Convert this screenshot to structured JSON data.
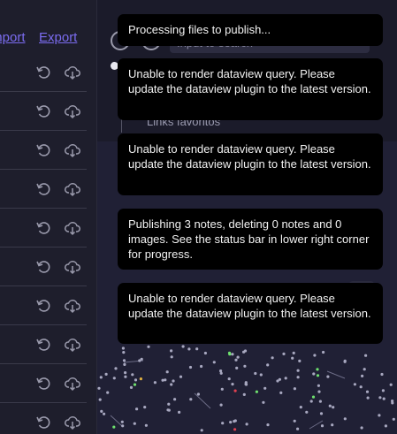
{
  "left_pane": {
    "links": {
      "import": "Import",
      "export": "Export"
    },
    "row_count": 10,
    "icons": {
      "reset": "reset-icon",
      "upload": "cloud-upload-icon"
    }
  },
  "right_pane": {
    "search_placeholder": "Input to search",
    "favorites_label": "Links favoritos",
    "icons": {
      "settings": "gear-icon",
      "magic": "wand-icon"
    }
  },
  "notices": [
    {
      "text": "Processing files to publish..."
    },
    {
      "text": "Unable to render dataview query. Please update the dataview plugin to the latest version."
    },
    {
      "text": "Unable to render dataview query. Please update the dataview plugin to the latest version."
    },
    {
      "text": "Publishing 3 notes, deleting 0 notes and 0 images. See the status bar in lower right corner for progress."
    },
    {
      "text": "Unable to render dataview query. Please update the dataview plugin to the latest version."
    }
  ],
  "colors": {
    "link": "#7b6cf0",
    "notice_bg": "#000000",
    "node_green": "#6ee06e",
    "node_yellow": "#e0b040",
    "node_red": "#e04050"
  }
}
